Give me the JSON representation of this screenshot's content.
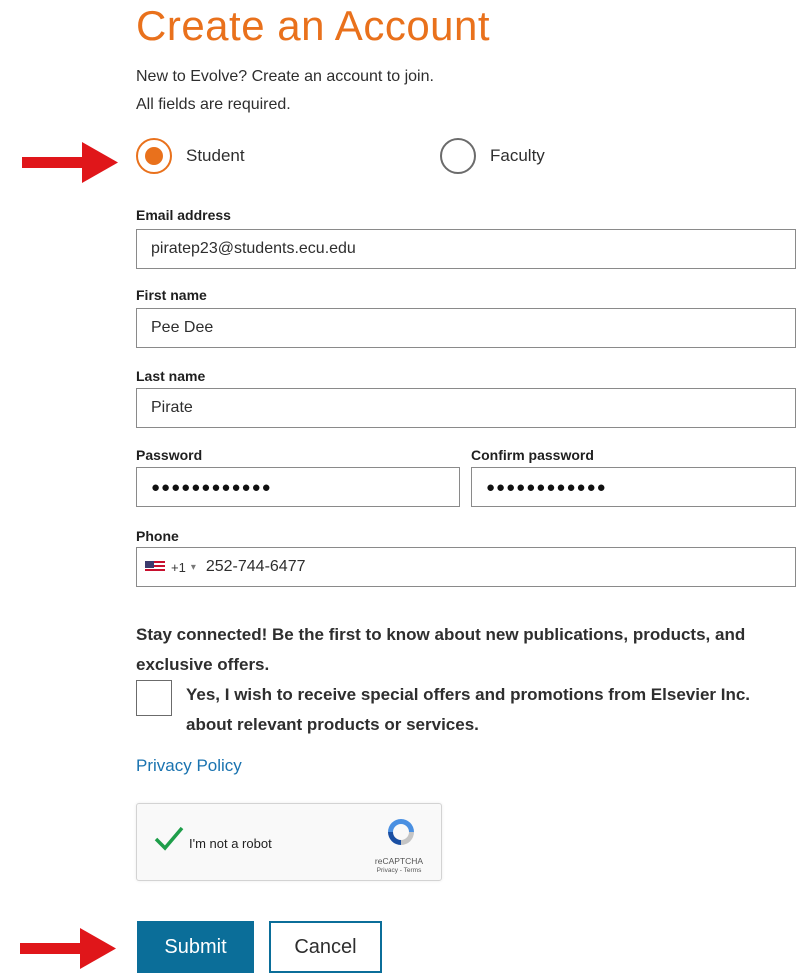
{
  "page": {
    "title": "Create an Account",
    "intro_line1": "New to Evolve? Create an account to join.",
    "intro_line2": "All fields are required."
  },
  "colors": {
    "accent": "#e9711c",
    "primary": "#0b6e99",
    "link": "#1a73b0",
    "annotation_arrow": "#e0161a"
  },
  "account_type": {
    "options": [
      {
        "label": "Student",
        "selected": true
      },
      {
        "label": "Faculty",
        "selected": false
      }
    ]
  },
  "form": {
    "email": {
      "label": "Email address",
      "value": "piratep23@students.ecu.edu"
    },
    "first_name": {
      "label": "First name",
      "value": "Pee Dee"
    },
    "last_name": {
      "label": "Last name",
      "value": "Pirate"
    },
    "password": {
      "label": "Password",
      "value": "●●●●●●●●●●●●"
    },
    "confirm_password": {
      "label": "Confirm password",
      "value": "●●●●●●●●●●●●"
    },
    "phone": {
      "label": "Phone",
      "country_icon": "us-flag-icon",
      "country_code": "+1",
      "value": "252-744-6477"
    }
  },
  "marketing": {
    "heading": "Stay connected! Be the first to know about new publications, products, and exclusive offers.",
    "checkbox_label": "Yes, I wish to receive special offers and promotions from Elsevier Inc. about relevant products or services.",
    "checked": false,
    "privacy_link": "Privacy Policy"
  },
  "captcha": {
    "label": "I'm not a robot",
    "checked": true,
    "brand": "reCAPTCHA",
    "terms": "Privacy - Terms",
    "icon": "recaptcha-logo-icon"
  },
  "actions": {
    "submit": "Submit",
    "cancel": "Cancel"
  }
}
